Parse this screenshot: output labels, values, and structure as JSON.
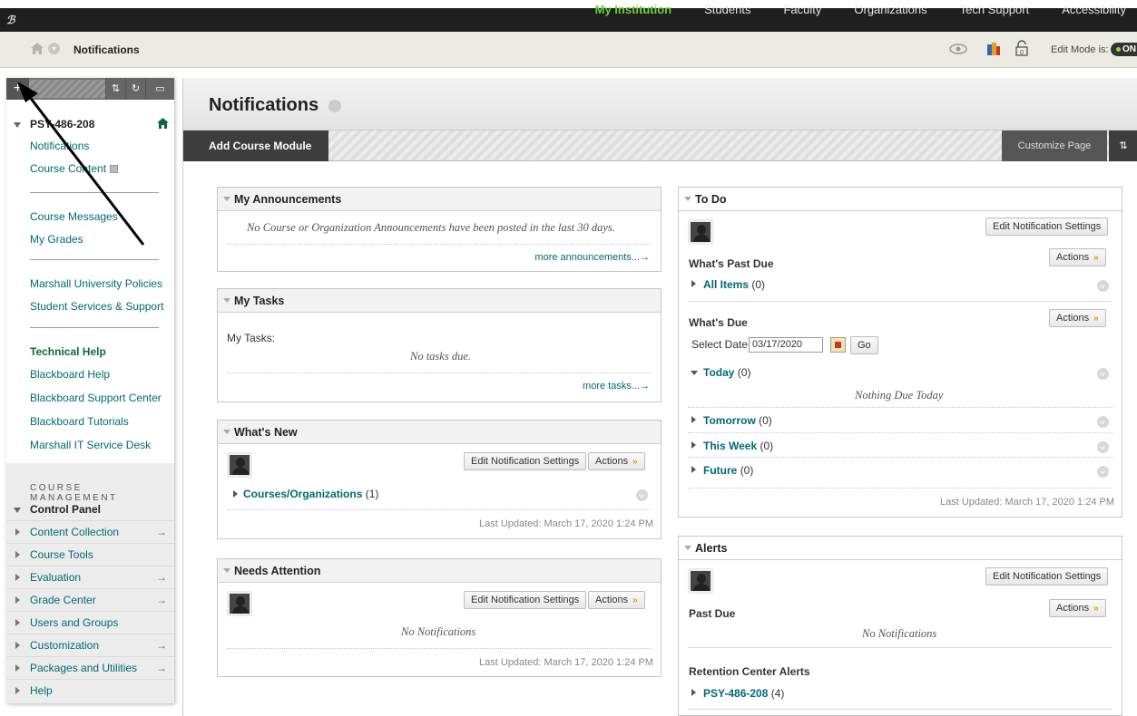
{
  "topnav": {
    "items": [
      "My Institution",
      "Students",
      "Faculty",
      "Organizations",
      "Tech Support",
      "Accessibility"
    ],
    "active_index": 0
  },
  "breadcrumb": {
    "title": "Notifications"
  },
  "edit_mode": {
    "label": "Edit Mode is:",
    "state": "ON"
  },
  "left_menu": {
    "course_id": "PSY-486-208",
    "items": [
      {
        "label": "Notifications"
      },
      {
        "label": "Course Content"
      },
      {
        "label": "Course Messages"
      },
      {
        "label": "My Grades"
      },
      {
        "label": "Marshall University Policies"
      },
      {
        "label": "Student Services & Support"
      },
      {
        "label": "Technical Help"
      },
      {
        "label": "Blackboard Help"
      },
      {
        "label": "Blackboard Support Center"
      },
      {
        "label": "Blackboard Tutorials"
      },
      {
        "label": "Marshall IT Service Desk"
      }
    ],
    "course_management": {
      "title": "COURSE MANAGEMENT",
      "control_panel": "Control Panel",
      "items": [
        "Content Collection",
        "Course Tools",
        "Evaluation",
        "Grade Center",
        "Users and Groups",
        "Customization",
        "Packages and Utilities",
        "Help"
      ]
    }
  },
  "page": {
    "title": "Notifications",
    "add_module": "Add Course Module",
    "customize": "Customize Page"
  },
  "announcements": {
    "title": "My Announcements",
    "empty": "No Course or Organization Announcements have been posted in the last 30 days.",
    "more": "more announcements...→"
  },
  "tasks": {
    "title": "My Tasks",
    "label": "My Tasks:",
    "empty": "No tasks due.",
    "more": "more tasks...→"
  },
  "whats_new": {
    "title": "What's New",
    "edit_btn": "Edit Notification Settings",
    "actions_btn": "Actions",
    "item_label": "Courses/Organizations",
    "item_count": "(1)",
    "updated": "Last Updated: March 17, 2020 1:24 PM"
  },
  "needs_attention": {
    "title": "Needs Attention",
    "edit_btn": "Edit Notification Settings",
    "actions_btn": "Actions",
    "empty": "No Notifications",
    "updated": "Last Updated: March 17, 2020 1:24 PM"
  },
  "todo": {
    "title": "To Do",
    "edit_btn": "Edit Notification Settings",
    "past_due_title": "What's Past Due",
    "actions_btn": "Actions",
    "all_items": "All Items",
    "all_items_count": "(0)",
    "due_title": "What's Due",
    "select_date_label": "Select Date:",
    "date_value": "03/17/2020",
    "go_btn": "Go",
    "today": "Today",
    "today_count": "(0)",
    "nothing_today": "Nothing Due Today",
    "tomorrow": "Tomorrow",
    "tomorrow_count": "(0)",
    "this_week": "This Week",
    "this_week_count": "(0)",
    "future": "Future",
    "future_count": "(0)",
    "updated": "Last Updated: March 17, 2020 1:24 PM"
  },
  "alerts": {
    "title": "Alerts",
    "edit_btn": "Edit Notification Settings",
    "actions_btn": "Actions",
    "past_due_title": "Past Due",
    "empty": "No Notifications",
    "retention_title": "Retention Center Alerts",
    "course": "PSY-486-208",
    "course_count": "(4)"
  }
}
